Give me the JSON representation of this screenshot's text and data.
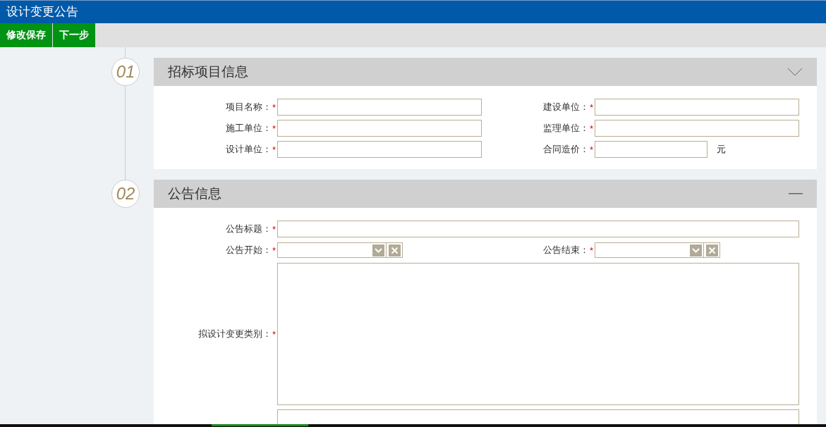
{
  "window": {
    "title": "设计变更公告"
  },
  "toolbar": {
    "buttons": [
      {
        "label": "修改保存"
      },
      {
        "label": "下一步"
      }
    ]
  },
  "sections": [
    {
      "number": "01",
      "title": "招标项目信息",
      "toggle": {
        "kind": "chevron"
      },
      "rows": [
        {
          "fields": [
            {
              "kind": "text",
              "label": "项目名称：",
              "required_mark": "*"
            },
            {
              "kind": "text",
              "label": "建设单位：",
              "required_mark": "*"
            }
          ]
        },
        {
          "fields": [
            {
              "kind": "text",
              "label": "施工单位：",
              "required_mark": "*"
            },
            {
              "kind": "text",
              "label": "监理单位：",
              "required_mark": "*"
            }
          ]
        },
        {
          "fields": [
            {
              "kind": "text",
              "label": "设计单位：",
              "required_mark": "*"
            },
            {
              "kind": "money",
              "label": "合同造价：",
              "required_mark": "*",
              "unit": "元"
            }
          ]
        }
      ]
    },
    {
      "number": "02",
      "title": "公告信息",
      "toggle": {
        "kind": "minus"
      },
      "rows": [
        {
          "fields": [
            {
              "kind": "wide",
              "label": "公告标题：",
              "required_mark": "*"
            }
          ]
        },
        {
          "fields": [
            {
              "kind": "date",
              "label": "公告开始：",
              "required_mark": "*"
            },
            {
              "kind": "date",
              "label": "公告结束：",
              "required_mark": "*"
            }
          ]
        },
        {
          "fields": [
            {
              "kind": "textarea",
              "label": "拟设计变更类别：",
              "required_mark": "*"
            }
          ]
        },
        {
          "fields": [
            {
              "kind": "textarea"
            }
          ]
        }
      ]
    }
  ]
}
